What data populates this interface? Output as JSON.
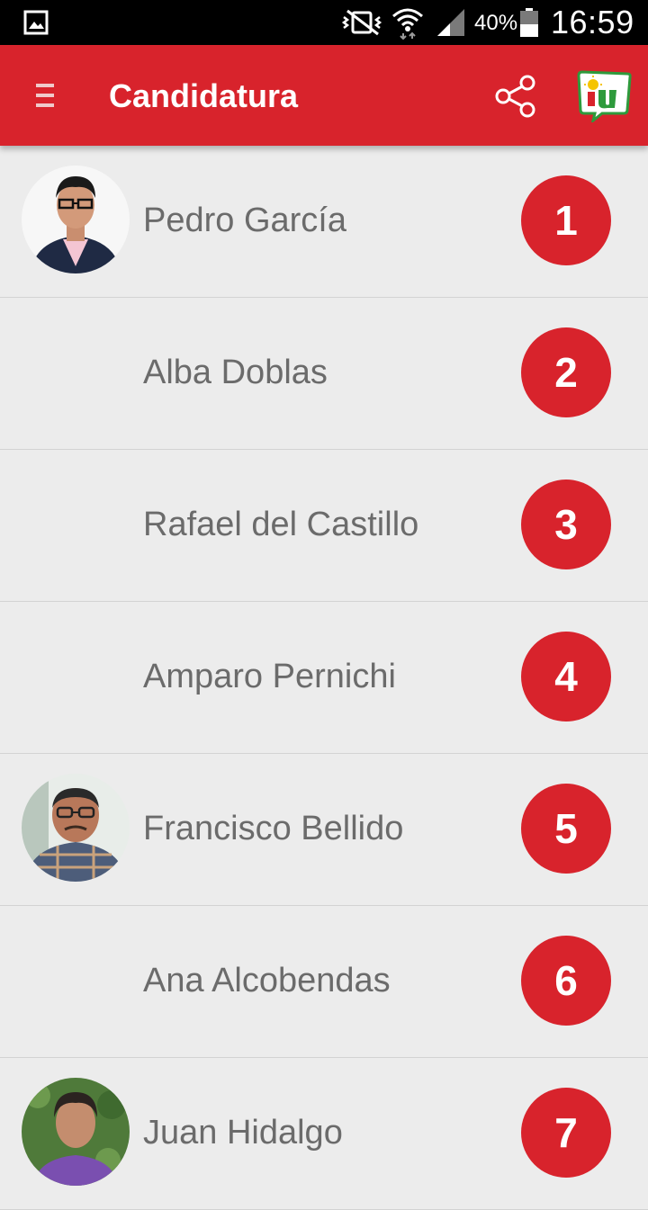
{
  "status_bar": {
    "battery_percent": "40%",
    "time": "16:59",
    "icons": [
      "gallery-icon",
      "mute-vibrate-icon",
      "wifi-icon",
      "signal-icon",
      "battery-icon"
    ]
  },
  "app_bar": {
    "title": "Candidatura",
    "icons": [
      "menu-icon",
      "share-icon",
      "iu-logo"
    ],
    "colors": {
      "primary": "#d8232c",
      "background": "#ececec",
      "text": "#6b6b6b"
    }
  },
  "candidates": [
    {
      "name": "Pedro García",
      "number": "1",
      "has_photo": true
    },
    {
      "name": "Alba Doblas",
      "number": "2",
      "has_photo": false
    },
    {
      "name": "Rafael del Castillo",
      "number": "3",
      "has_photo": false
    },
    {
      "name": "Amparo Pernichi",
      "number": "4",
      "has_photo": false
    },
    {
      "name": "Francisco Bellido",
      "number": "5",
      "has_photo": true
    },
    {
      "name": "Ana Alcobendas",
      "number": "6",
      "has_photo": false
    },
    {
      "name": "Juan Hidalgo",
      "number": "7",
      "has_photo": true
    }
  ]
}
